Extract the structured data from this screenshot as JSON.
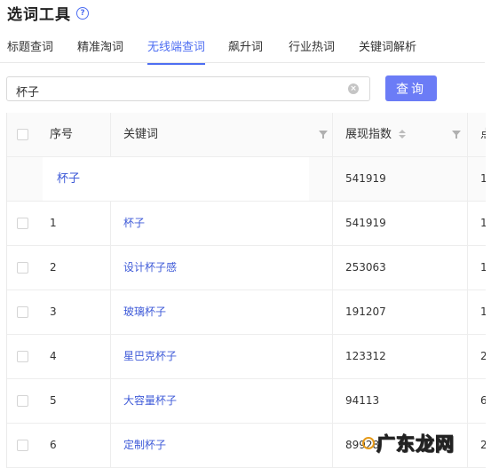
{
  "header": {
    "title": "选词工具",
    "help_icon": "question-circle-icon"
  },
  "tabs": [
    {
      "label": "标题查词",
      "active": false
    },
    {
      "label": "精准淘词",
      "active": false
    },
    {
      "label": "无线端查词",
      "active": true
    },
    {
      "label": "飙升词",
      "active": false
    },
    {
      "label": "行业热词",
      "active": false
    },
    {
      "label": "关键词解析",
      "active": false
    }
  ],
  "search": {
    "value": "杯子",
    "clear_icon": "clear-circle-icon",
    "button_label": "查询"
  },
  "table": {
    "columns": {
      "index": "序号",
      "keyword": "关键词",
      "impressions": "展现指数",
      "next": "点"
    },
    "summary": {
      "keyword": "杯子",
      "impressions": "541919",
      "next": "1"
    },
    "rows": [
      {
        "index": "1",
        "keyword": "杯子",
        "impressions": "541919",
        "next": "1"
      },
      {
        "index": "2",
        "keyword": "设计杯子感",
        "impressions": "253063",
        "next": "1"
      },
      {
        "index": "3",
        "keyword": "玻璃杯子",
        "impressions": "191207",
        "next": "1"
      },
      {
        "index": "4",
        "keyword": "星巴克杯子",
        "impressions": "123312",
        "next": "2"
      },
      {
        "index": "5",
        "keyword": "大容量杯子",
        "impressions": "94113",
        "next": "6"
      },
      {
        "index": "6",
        "keyword": "定制杯子",
        "impressions": "89928",
        "next": "2"
      }
    ]
  },
  "watermark": {
    "text": "广东龙网"
  },
  "colors": {
    "accent": "#4e6ef2",
    "button": "#6b7cf6",
    "link": "#3f5bd8"
  }
}
